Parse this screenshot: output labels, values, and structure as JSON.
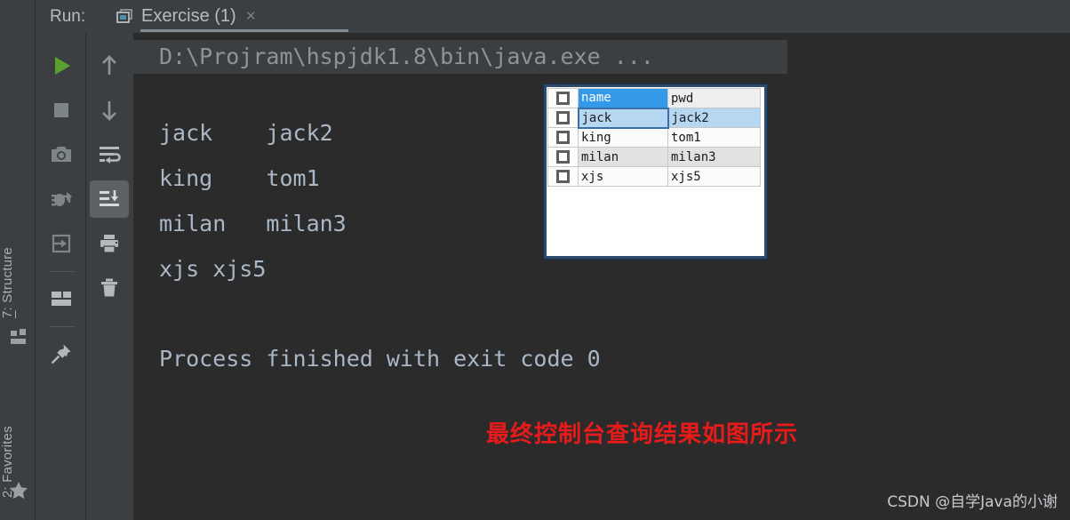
{
  "window": {
    "run_label": "Run:",
    "tab": {
      "title": "Exercise (1)",
      "close": "×",
      "icon": "run-configuration-icon"
    }
  },
  "left_sidebar": {
    "items": [
      {
        "label_prefix": "7",
        "label": ": Structure",
        "full": "7: Structure",
        "icon": "structure-icon"
      },
      {
        "label_prefix": "2",
        "label": ": Favorites",
        "full": "2: Favorites",
        "icon": "star-icon"
      }
    ]
  },
  "run_toolbar": {
    "column_one": [
      {
        "name": "rerun-button",
        "icon": "play-icon",
        "color": "#5aa02c"
      },
      {
        "name": "stop-button",
        "icon": "stop-square-icon"
      },
      {
        "name": "screenshot-button",
        "icon": "camera-icon"
      },
      {
        "name": "debug-button",
        "icon": "bug-icon"
      },
      {
        "name": "export-button",
        "icon": "enter-box-icon"
      },
      {
        "name": "layout-button",
        "icon": "layout-icon"
      },
      {
        "name": "pin-tab-button",
        "icon": "pin-icon"
      }
    ],
    "column_two": [
      {
        "name": "up-the-stack-trace-button",
        "icon": "arrow-up-icon"
      },
      {
        "name": "down-the-stack-trace-button",
        "icon": "arrow-down-icon"
      },
      {
        "name": "soft-wrap-button",
        "icon": "soft-wrap-icon"
      },
      {
        "name": "scroll-to-end-button",
        "icon": "scroll-to-end-icon",
        "active": true
      },
      {
        "name": "print-button",
        "icon": "printer-icon"
      },
      {
        "name": "clear-all-button",
        "icon": "trash-icon"
      }
    ]
  },
  "console": {
    "command_line": "D:\\Projram\\hspjdk1.8\\bin\\java.exe ...",
    "output_lines": [
      "jack    jack2",
      "king    tom1",
      "milan   milan3",
      "xjs xjs5"
    ],
    "finished_line": "Process finished with exit code 0"
  },
  "annotation": {
    "red_note": "最终控制台查询结果如图所示",
    "red_color": "#e81b1b"
  },
  "watermark": {
    "text": "CSDN @自学Java的小谢"
  },
  "result_table": {
    "columns": [
      "name",
      "pwd"
    ],
    "rows": [
      {
        "name": "name",
        "pwd": "pwd",
        "style": "header"
      },
      {
        "name": "jack",
        "pwd": "jack2",
        "style": "selected"
      },
      {
        "name": "king",
        "pwd": "tom1",
        "style": "white"
      },
      {
        "name": "milan",
        "pwd": "milan3",
        "style": "grey"
      },
      {
        "name": "xjs",
        "pwd": "xjs5",
        "style": "white"
      }
    ],
    "header_highlight_color": "#3399e8",
    "selected_row_color": "#b6d7f2"
  }
}
